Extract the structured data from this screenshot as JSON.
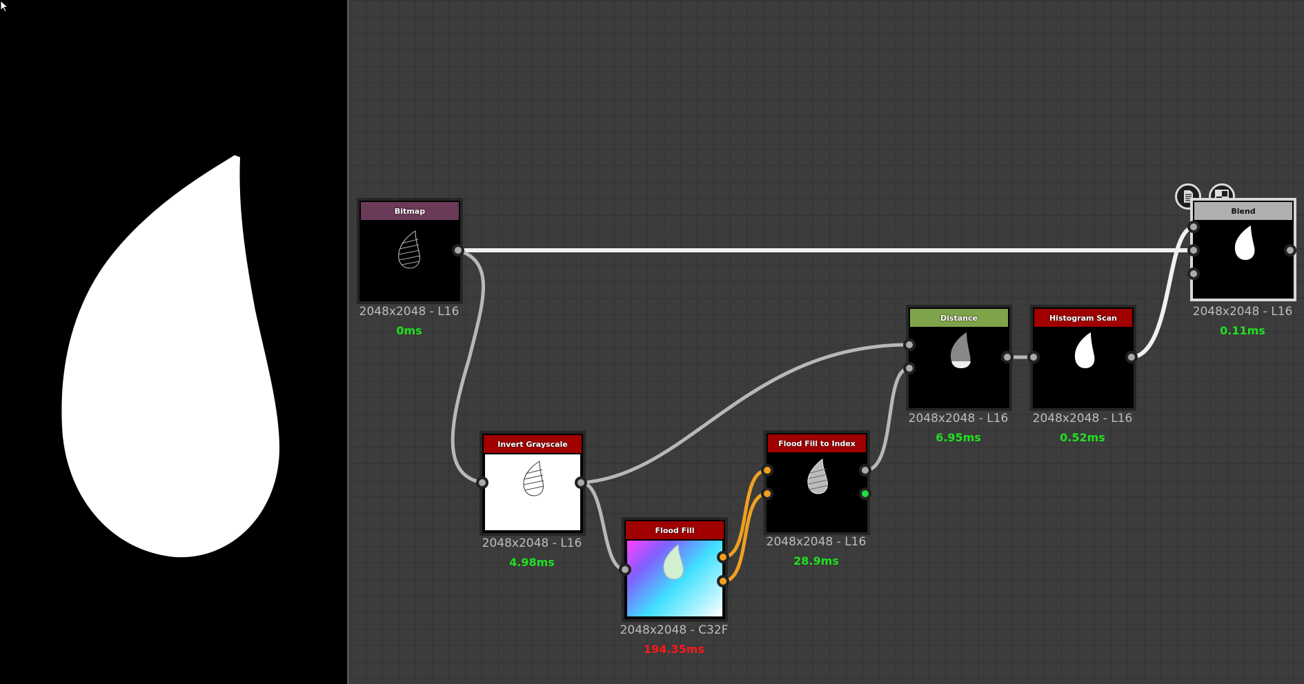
{
  "nodes": [
    {
      "id": "bitmap",
      "title": "Bitmap",
      "dims": "2048x2048 - L16",
      "time": "0ms"
    },
    {
      "id": "invert",
      "title": "Invert Grayscale",
      "dims": "2048x2048 - L16",
      "time": "4.98ms"
    },
    {
      "id": "floodfill",
      "title": "Flood Fill",
      "dims": "2048x2048 - C32F",
      "time": "194.35ms"
    },
    {
      "id": "ffindex",
      "title": "Flood Fill to Index",
      "dims": "2048x2048 - L16",
      "time": "28.9ms"
    },
    {
      "id": "distance",
      "title": "Distance",
      "dims": "2048x2048 - L16",
      "time": "6.95ms"
    },
    {
      "id": "histscan",
      "title": "Histogram Scan",
      "dims": "2048x2048 - L16",
      "time": "0.52ms"
    },
    {
      "id": "blend",
      "title": "Blend",
      "dims": "2048x2048 - L16",
      "time": "0.11ms"
    }
  ],
  "colors": {
    "bitmap_header": "#6b3a58",
    "red_header": "#a00000",
    "distance_header": "#7fa348",
    "blend_header": "#b0b0b0",
    "time_ok": "#20e020",
    "time_slow": "#ff1818",
    "wire_gray": "#b8b8b8",
    "wire_white": "#f0f0f0",
    "wire_orange": "#f0a020"
  },
  "icons": [
    "cursor-arrow-icon",
    "document-icon",
    "checker-preview-icon"
  ]
}
